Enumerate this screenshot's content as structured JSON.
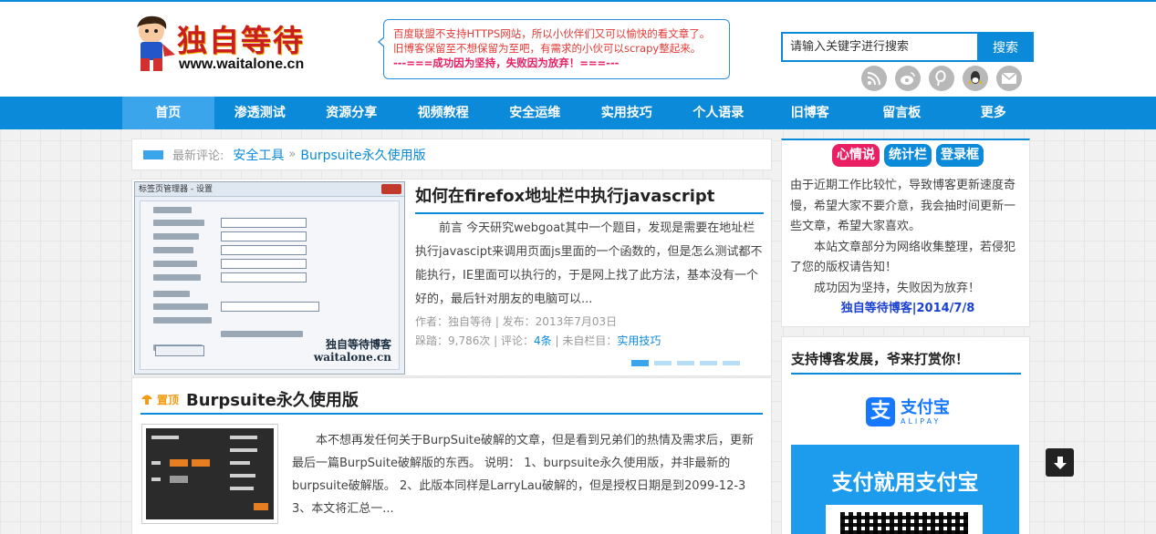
{
  "header": {
    "logo_title": "独自等待",
    "logo_url": "www.waitalone.cn",
    "notice_lines": [
      "百度联盟不支持HTTPS网站，所以小伙伴们又可以愉快的看文章了。",
      "旧博客保留至不想保留为至吧，有需求的小伙可以scrapy整起来。",
      "---===成功因为坚持，失败因为放弃！===---"
    ],
    "search_placeholder": "请输入关键字进行搜索",
    "search_button": "搜索",
    "socials": [
      "rss-icon",
      "weibo-icon",
      "pinterest-icon",
      "qq-icon",
      "mail-icon"
    ]
  },
  "nav": {
    "items": [
      "首页",
      "渗透测试",
      "资源分享",
      "视频教程",
      "安全运维",
      "实用技巧",
      "个人语录",
      "旧博客",
      "留言板",
      "更多"
    ]
  },
  "recent": {
    "label": "最新评论:",
    "category": "安全工具",
    "separator": "»",
    "post": "Burpsuite永久使用版"
  },
  "slide": {
    "thumb_caption_line1": "独自等待博客",
    "thumb_caption_line2": "waitalone.cn",
    "thumb_dialog_title": "标签页管理器 - 设置",
    "title": "如何在firefox地址栏中执行javascript",
    "excerpt": "前言 今天研究webgoat其中一个题目，发现是需要在地址栏执行javascipt来调用页面js里面的一个函数的，但是怎么测试都不能执行，IE里面可以执行的，于是网上找了此方法，基本没有一个好的，最后针对朋友的电脑可以...",
    "meta_line1": "作者：独自等待 | 发布：2013年7月03日",
    "meta_prefix": "跺踏：9,786次 | 评论：",
    "meta_comments": "4条",
    "meta_mid": " | 未自栏目：",
    "meta_category": "实用技巧"
  },
  "post": {
    "badge": "置顶",
    "title": "Burpsuite永久使用版",
    "excerpt": "本不想再发任何关于BurpSuite破解的文章，但是看到兄弟们的热情及需求后，更新最后一篇BurpSuite破解版的东西。 说明： 1、burpsuite永久使用版，并非最新的burpsuite破解版。 2、此版本同样是LarryLau破解的，但是授权日期是到2099-12-3 3、本文将汇总一..."
  },
  "sidebar": {
    "tabs": [
      "心情说",
      "统计栏",
      "登录框"
    ],
    "mood_p1": "由于近期工作比较忙，导致博客更新速度奇慢，希望大家不要介意，我会抽时间更新一些文章，希望大家喜欢。",
    "mood_p2": "本站文章部分为网络收集整理，若侵犯了您的版权请告知！",
    "mood_p3": "成功因为坚持，失败因为放弃！",
    "signature": "独自等待博客|2014/7/8",
    "donate_title": "支持博客发展，爷来打赏你！",
    "alipay_name": "支付宝",
    "alipay_en": "ALIPAY",
    "alipay_slogan": "支付就用支付宝"
  },
  "colors": {
    "brand_blue": "#0b8ad9",
    "active_tab_pink": "#e91e63",
    "notice_red": "#e53935"
  }
}
